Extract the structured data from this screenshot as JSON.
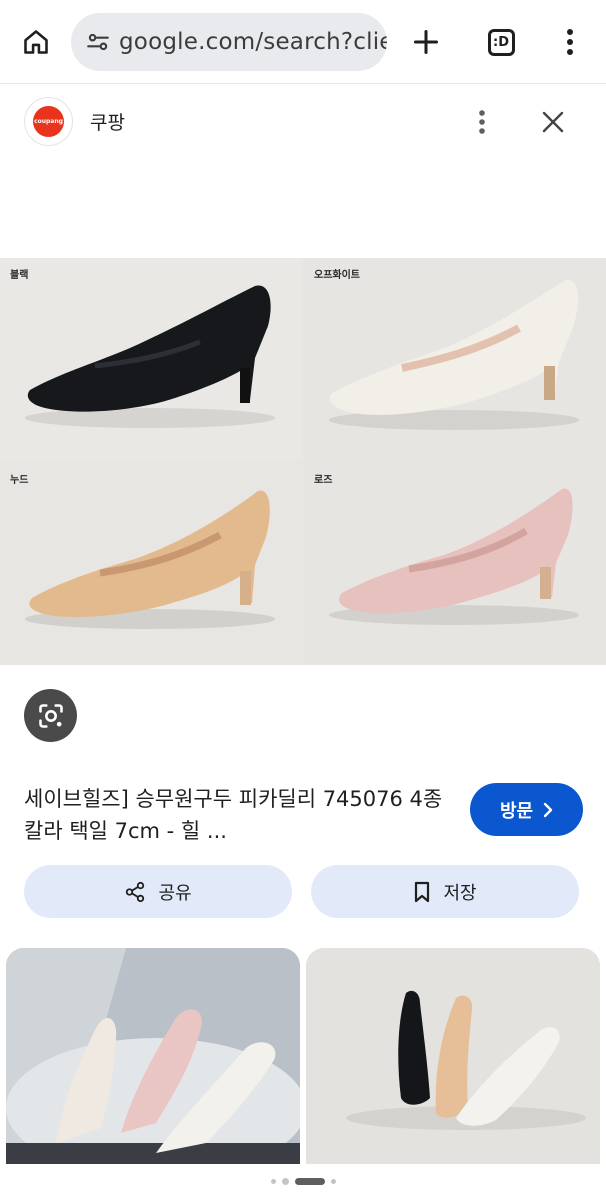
{
  "browser": {
    "url": "google.com/search?clie",
    "tab_icon_label": ":D"
  },
  "source": {
    "logo_text": "coupang",
    "name": "쿠팡"
  },
  "image": {
    "labels": [
      "블랙",
      "오프화이트",
      "누드",
      "로즈"
    ]
  },
  "result": {
    "title": "세이브힐즈] 승무원구두 피카딜리 745076 4종 칼라 택일 7cm - 힐 ...",
    "visit_label": "방문"
  },
  "actions": {
    "share_label": "공유",
    "save_label": "저장"
  },
  "colors": {
    "accent": "#0b57d0",
    "pill_bg": "#e2e9f8",
    "brand": "#e8341c"
  },
  "icons": [
    "home-icon",
    "tune-icon",
    "plus-icon",
    "tabs-icon",
    "more-vert-icon",
    "close-icon",
    "lens-icon",
    "chevron-right-icon",
    "share-icon",
    "bookmark-icon"
  ]
}
